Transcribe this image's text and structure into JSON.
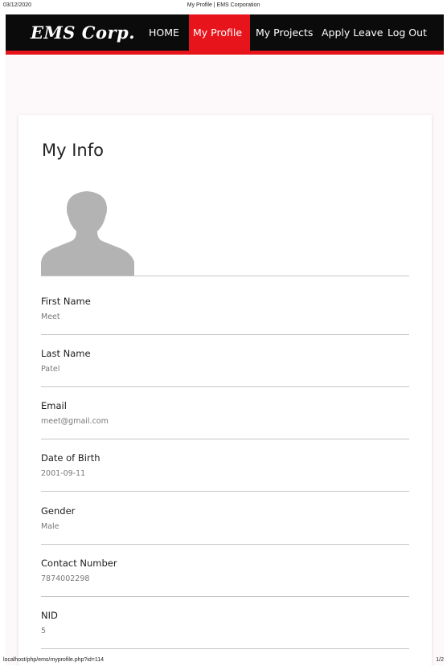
{
  "print": {
    "date": "03/12/2020",
    "title": "My Profile | EMS Corporation",
    "url": "localhost/php/ems/myprofile.php?id=114",
    "page": "1/2"
  },
  "nav": {
    "brand": "EMS Corp.",
    "items": [
      {
        "label": "HOME",
        "active": false
      },
      {
        "label": "My Profile",
        "active": true
      },
      {
        "label": "My Projects",
        "active": false
      },
      {
        "label": "Apply Leave",
        "active": false
      },
      {
        "label": "Log Out",
        "active": false
      }
    ]
  },
  "profile": {
    "heading": "My Info",
    "avatar_icon": "user-silhouette-icon",
    "fields": [
      {
        "label": "First Name",
        "value": "Meet"
      },
      {
        "label": "Last Name",
        "value": "Patel"
      },
      {
        "label": "Email",
        "value": "meet@gmail.com"
      },
      {
        "label": "Date of Birth",
        "value": "2001-09-11"
      },
      {
        "label": "Gender",
        "value": "Male"
      },
      {
        "label": "Contact Number",
        "value": "7874002298"
      },
      {
        "label": "NID",
        "value": "5"
      }
    ]
  },
  "colors": {
    "nav_background": "#0b0b0b",
    "accent": "#e8141b",
    "page_tint": "#fdf9fb",
    "avatar": "#b3b3b3"
  }
}
